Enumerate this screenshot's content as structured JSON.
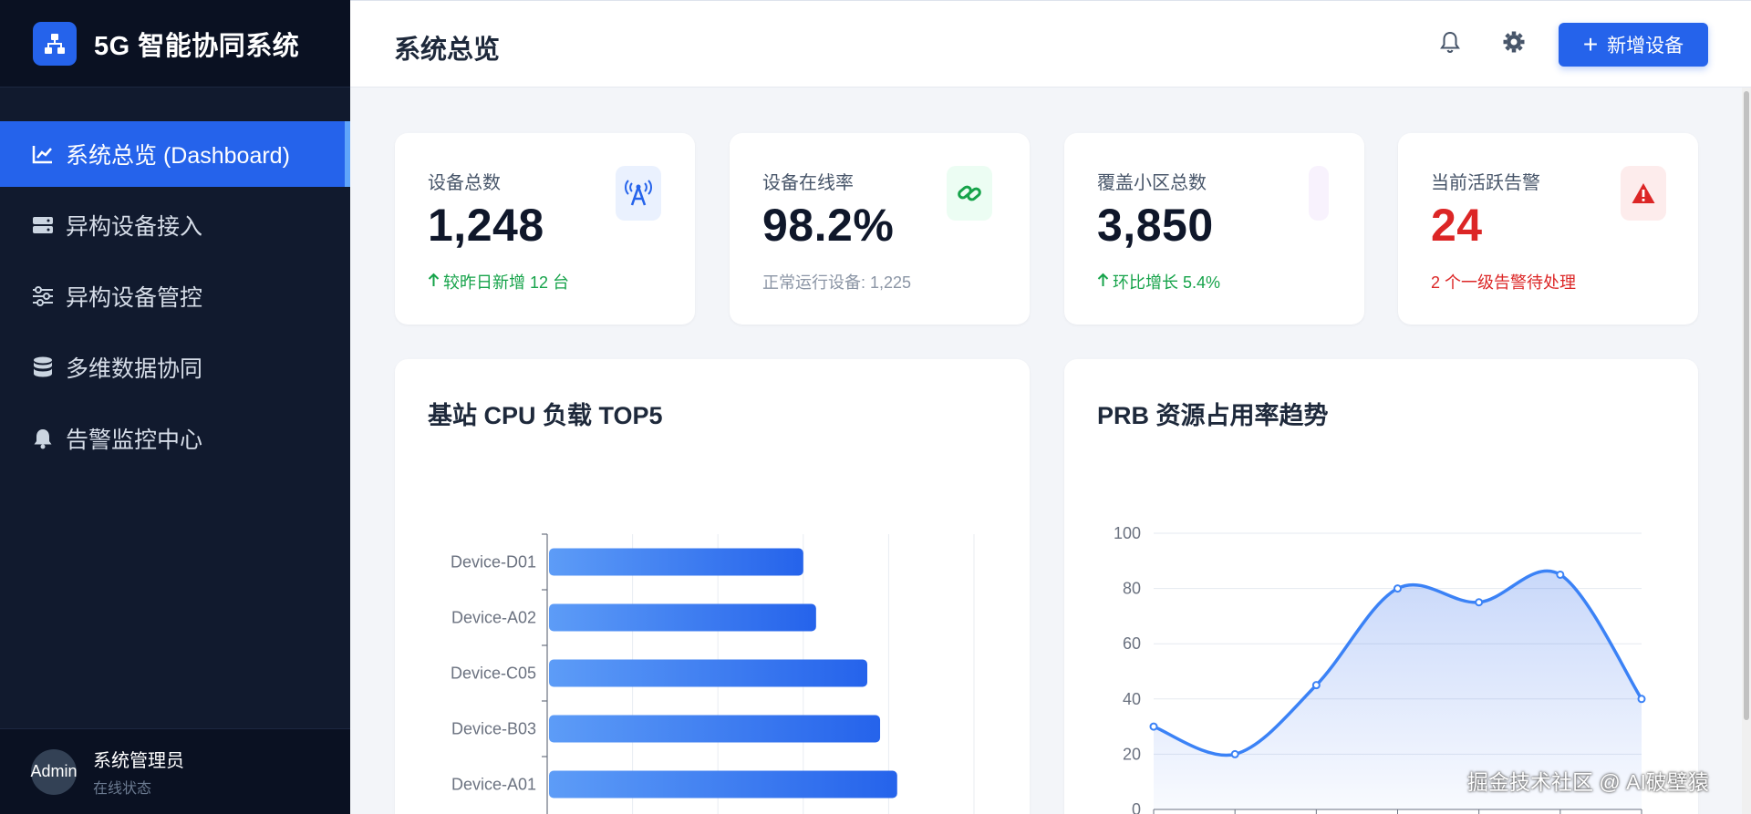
{
  "app": {
    "name": "5G 智能协同系统"
  },
  "sidebar": {
    "items": [
      {
        "label": "系统总览 (Dashboard)",
        "icon": "chart-line-icon",
        "active": true
      },
      {
        "label": "异构设备接入",
        "icon": "server-icon"
      },
      {
        "label": "异构设备管控",
        "icon": "sliders-icon"
      },
      {
        "label": "多维数据协同",
        "icon": "database-icon"
      },
      {
        "label": "告警监控中心",
        "icon": "bell-icon"
      }
    ],
    "user": {
      "avatar": "Admin",
      "name": "系统管理员",
      "status": "在线状态"
    }
  },
  "header": {
    "title": "系统总览",
    "add_button": "新增设备"
  },
  "stats": [
    {
      "label": "设备总数",
      "value": "1,248",
      "note": "较昨日新增 12 台",
      "icon": "tower-broadcast-icon"
    },
    {
      "label": "设备在线率",
      "value": "98.2%",
      "note": "正常运行设备: 1,225",
      "icon": "link-icon"
    },
    {
      "label": "覆盖小区总数",
      "value": "3,850",
      "note": "环比增长 5.4%",
      "icon": "map-icon"
    },
    {
      "label": "当前活跃告警",
      "value": "24",
      "note": "2 个一级告警待处理",
      "icon": "warning-icon"
    }
  ],
  "colors": {
    "accent": "#2563eb",
    "sidebar": "#111a2e",
    "success": "#16a34a",
    "danger": "#dc2626"
  },
  "charts": {
    "cpu_title": "基站 CPU 负载 TOP5",
    "prb_title": "PRB 资源占用率趋势"
  },
  "chart_data": [
    {
      "type": "bar",
      "orientation": "horizontal",
      "title": "基站 CPU 负载 TOP5",
      "categories": [
        "Device-D01",
        "Device-A02",
        "Device-C05",
        "Device-B03",
        "Device-A01"
      ],
      "values": [
        60,
        63,
        75,
        78,
        82
      ],
      "xlim": [
        0,
        100
      ],
      "grid": true
    },
    {
      "type": "area",
      "title": "PRB 资源占用率趋势",
      "values": [
        30,
        20,
        45,
        80,
        75,
        85,
        40
      ],
      "ylim": [
        0,
        100
      ],
      "yticks": [
        0,
        20,
        40,
        60,
        80,
        100
      ],
      "smooth": true,
      "grid": true
    }
  ],
  "watermark": "掘金技术社区 @ AI破壁猿"
}
